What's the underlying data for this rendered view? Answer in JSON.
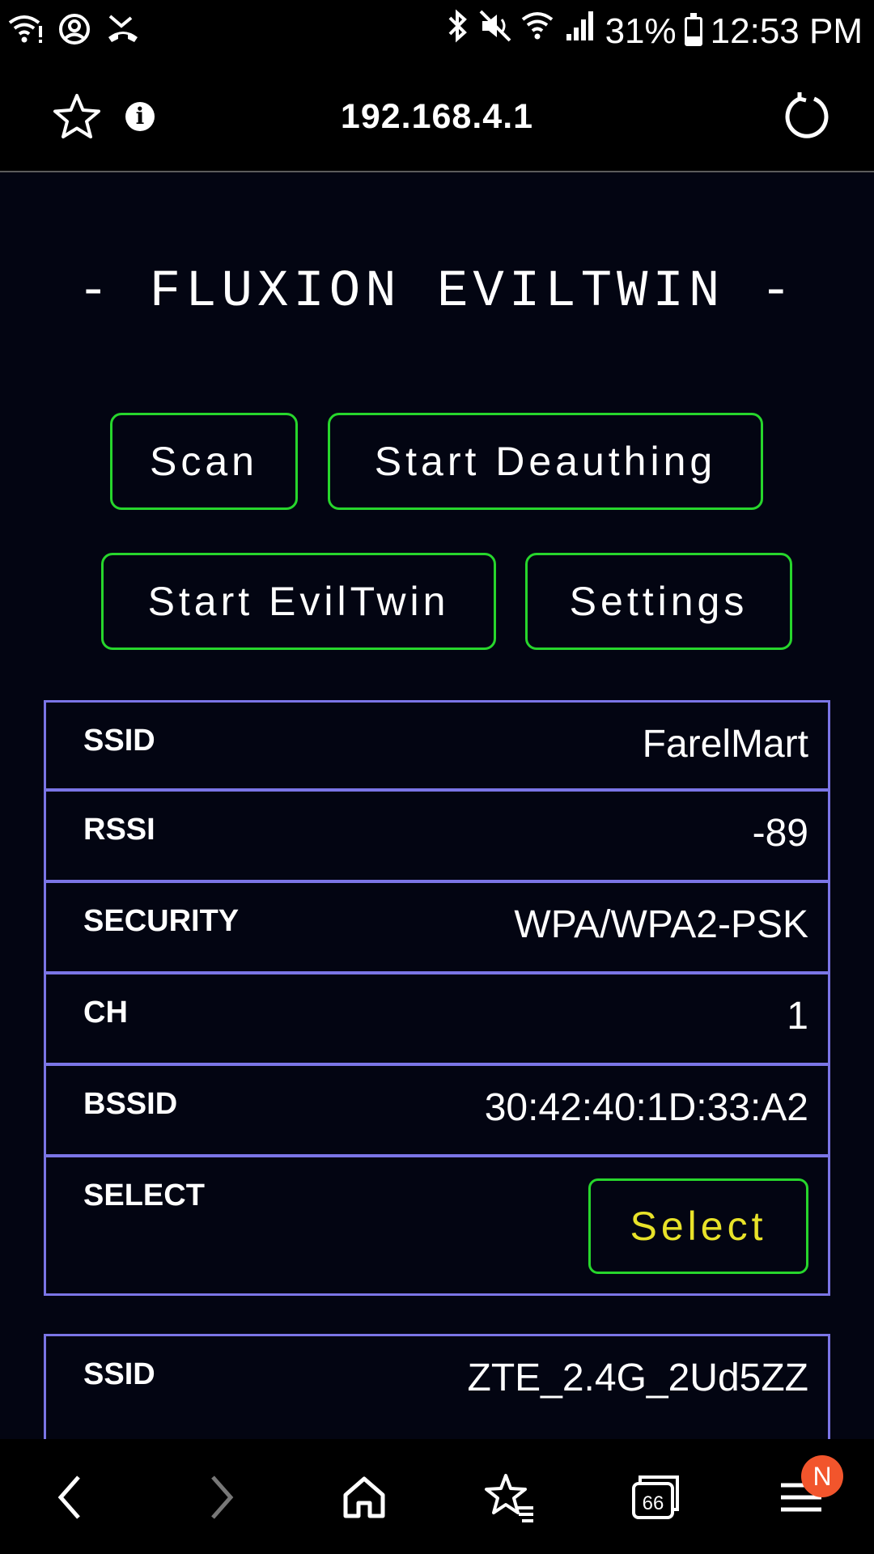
{
  "status_bar": {
    "battery": "31%",
    "battery_level": 0.31,
    "time": "12:53 PM",
    "icons": [
      "wifi-alert-icon",
      "account-circle-icon",
      "missed-call-icon",
      "bluetooth-icon",
      "mute-icon",
      "wifi-icon",
      "signal-icon",
      "battery-icon"
    ]
  },
  "browser": {
    "url": "192.168.4.1",
    "tab_count": "66",
    "notification_badge": "N"
  },
  "page": {
    "title": "- FLUXION EVILTWIN -",
    "buttons": {
      "scan": "Scan",
      "start_deauthing": "Start Deauthing",
      "start_eviltwin": "Start EvilTwin",
      "settings": "Settings"
    },
    "networks": [
      {
        "ssid_label": "SSID",
        "ssid": "FarelMart",
        "rssi_label": "RSSI",
        "rssi": "-89",
        "security_label": "SECURITY",
        "security": "WPA/WPA2-PSK",
        "ch_label": "CH",
        "ch": "1",
        "bssid_label": "BSSID",
        "bssid": "30:42:40:1D:33:A2",
        "select_label": "SELECT",
        "select_button": "Select"
      },
      {
        "ssid_label": "SSID",
        "ssid": "ZTE_2.4G_2Ud5ZZ"
      }
    ]
  },
  "colors": {
    "page_bg": "#030512",
    "button_border": "#27d62c",
    "table_border": "#7b75e6",
    "select_text": "#e8e229",
    "badge": "#f2552c"
  }
}
